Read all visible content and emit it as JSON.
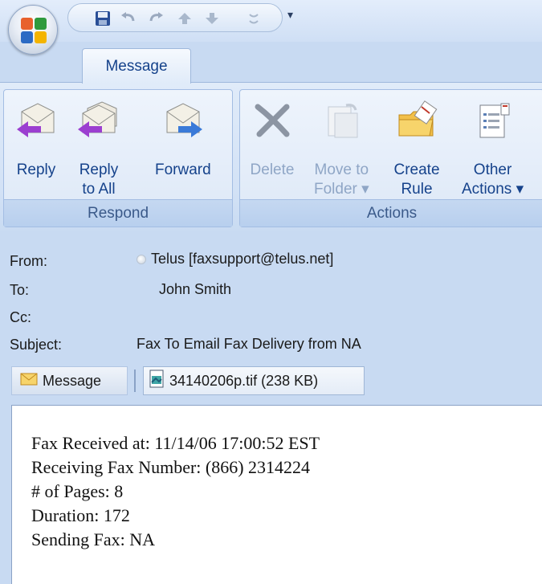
{
  "ribbon": {
    "tab": "Message",
    "groups": {
      "respond": {
        "label": "Respond",
        "reply": "Reply",
        "reply_all_1": "Reply",
        "reply_all_2": "to All",
        "forward": "Forward"
      },
      "actions": {
        "label": "Actions",
        "delete": "Delete",
        "move_1": "Move to",
        "move_2": "Folder ▾",
        "create_1": "Create",
        "create_2": "Rule",
        "other_1": "Other",
        "other_2": "Actions ▾"
      }
    }
  },
  "header": {
    "from_label": "From:",
    "from_value": "Telus [faxsupport@telus.net]",
    "to_label": "To:",
    "to_value": "John Smith",
    "cc_label": "Cc:",
    "cc_value": "",
    "subject_label": "Subject:",
    "subject_value": "Fax To Email Fax Delivery from NA"
  },
  "attachments": {
    "message_tab": "Message",
    "file": "34140206p.tif (238 KB)"
  },
  "body": {
    "lines": [
      "Fax Received at: 11/14/06 17:00:52 EST",
      "Receiving Fax Number: (866) 2314224",
      "# of Pages: 8",
      "Duration: 172",
      "Sending Fax: NA"
    ]
  },
  "icons": {
    "office": "office-logo-icon",
    "save": "save-icon",
    "undo": "undo-icon",
    "redo": "redo-icon",
    "previous": "up-arrow-icon",
    "next": "down-arrow-icon"
  },
  "colors": {
    "ribbon_text": "#15428b",
    "frame": "#c8daf2"
  }
}
